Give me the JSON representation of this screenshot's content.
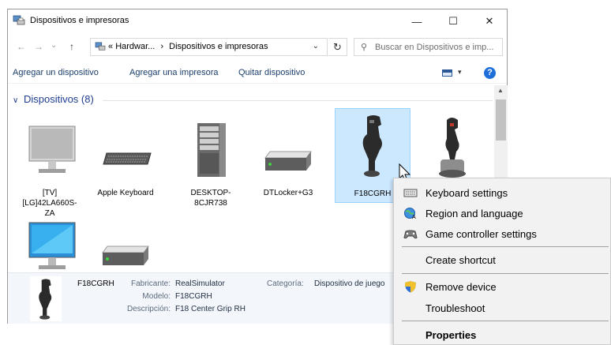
{
  "window": {
    "title": "Dispositivos e impresoras",
    "minimize": "—",
    "maximize": "☐",
    "close": "✕"
  },
  "address_bar": {
    "back": "←",
    "forward": "→",
    "history": "⌄",
    "up": "↑",
    "overflow": "«",
    "crumb1": "Hardwar...",
    "separator": "›",
    "crumb2": "Dispositivos e impresoras",
    "dropdown": "⌄",
    "refresh": "↻",
    "search_icon": "⚲",
    "search_placeholder": "Buscar en Dispositivos e imp..."
  },
  "command_bar": {
    "add_device": "Agregar un dispositivo",
    "add_printer": "Agregar una impresora",
    "remove_device": "Quitar dispositivo",
    "view_drop": "▾",
    "help": "?"
  },
  "group": {
    "chevron": "∨",
    "title": "Dispositivos (8)"
  },
  "devices": [
    {
      "label": "[TV][LG]42LA660S-ZA",
      "icon": "tv-monitor-icon"
    },
    {
      "label": "Apple Keyboard",
      "icon": "keyboard-icon"
    },
    {
      "label": "DESKTOP-8CJR738",
      "icon": "computer-tower-icon"
    },
    {
      "label": "DTLocker+G3",
      "icon": "external-drive-icon"
    },
    {
      "label": "F18CGRH",
      "icon": "joystick-icon"
    },
    {
      "label": "",
      "icon": "joystick-throttle-icon"
    },
    {
      "label": "",
      "icon": "monitor-icon"
    },
    {
      "label": "",
      "icon": "external-drive-icon"
    }
  ],
  "details": {
    "name": "F18CGRH",
    "manufacturer_label": "Fabricante:",
    "manufacturer": "RealSimulator",
    "model_label": "Modelo:",
    "model": "F18CGRH",
    "description_label": "Descripción:",
    "description": "F18 Center Grip RH",
    "category_label": "Categoría:",
    "category": "Dispositivo de juego"
  },
  "context_menu": {
    "keyboard_settings": "Keyboard settings",
    "region_language": "Region and language",
    "game_controller": "Game controller settings",
    "create_shortcut": "Create shortcut",
    "remove_device": "Remove device",
    "troubleshoot": "Troubleshoot",
    "properties": "Properties"
  },
  "colors": {
    "link": "#1a3e6b",
    "group_header": "#1e3d8f",
    "selection": "#cce8ff",
    "menu_bg": "#f2f2f2"
  }
}
